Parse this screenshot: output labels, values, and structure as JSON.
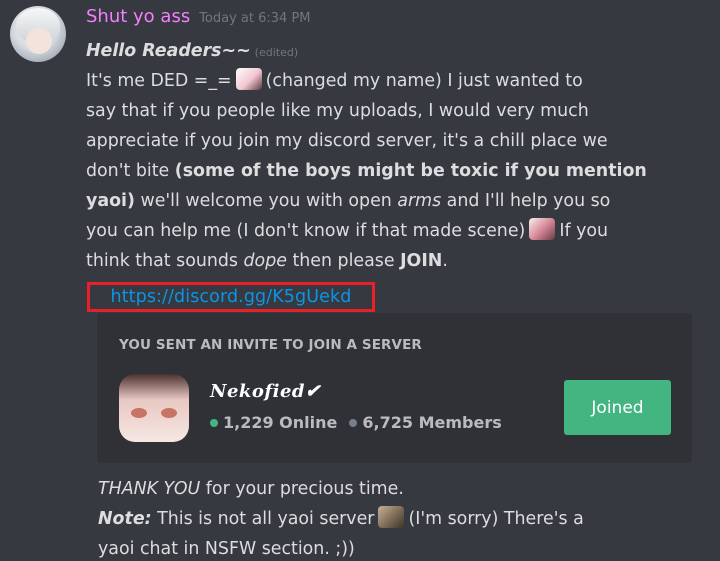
{
  "message": {
    "username": "Shut yo ass",
    "timestamp": "Today at 6:34 PM",
    "greeting": "Hello Readers~~",
    "edited": "(edited)",
    "p1_a": "It's me DED =_=",
    "p1_b": "(changed my name)  I just wanted to",
    "p2": "say that if you people like my uploads, I would very much",
    "p3": "appreciate if you join my discord server, it's a chill place we",
    "p4_a": "don't bite ",
    "p4_b": "(some of the boys might be toxic if you mention",
    "p5_a": "yaoi)",
    "p5_b": " we'll welcome you with open ",
    "p5_c": "arms",
    "p5_d": " and I'll help you so",
    "p6_a": "you can help me (I don't know if that made scene)",
    "p6_b": "If you",
    "p7_a": "think that sounds ",
    "p7_b": "dope",
    "p7_c": " then please ",
    "p7_d": "JOIN",
    "p7_e": ".",
    "link": "https://discord.gg/K5gUekd",
    "emojis": [
      "panda-emoji",
      "cow-emoji",
      "cat-emoji"
    ]
  },
  "invite": {
    "title": "YOU SENT AN INVITE TO JOIN A SERVER",
    "server_name": "Nekofied✔",
    "online": "1,229 Online",
    "members": "6,725 Members",
    "button": "Joined",
    "button_color": "#43b581"
  },
  "footer": {
    "thanks_a": "THANK YOU",
    "thanks_b": "  for your precious time.",
    "note_label": "Note:",
    "note_a": "  This is not all yaoi server",
    "note_b": "(I'm sorry) There's a",
    "note_c": "yaoi chat in NSFW section. ;))"
  },
  "colors": {
    "background": "#36393f",
    "username": "#f47fff",
    "link": "#0c95e6",
    "highlight_box": "#e8202a"
  }
}
